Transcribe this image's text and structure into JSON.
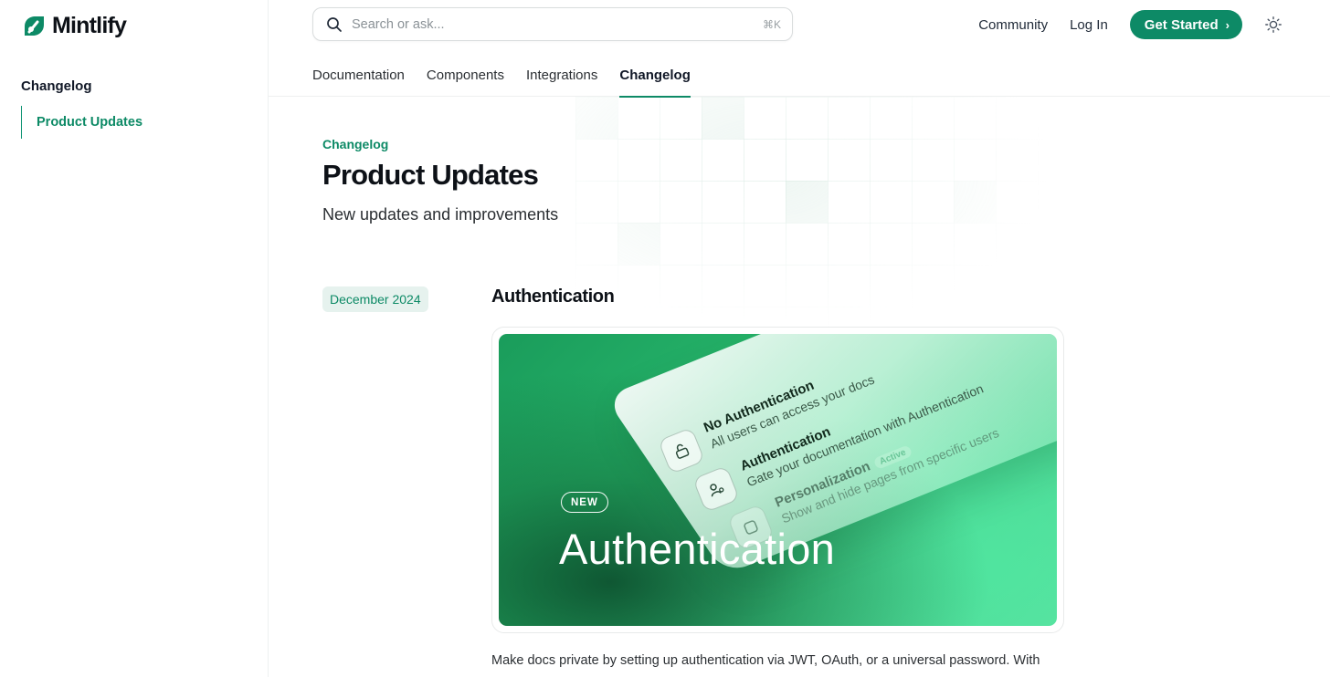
{
  "brand": {
    "name": "Mintlify",
    "accent": "#0d8a66"
  },
  "sidebar": {
    "group": "Changelog",
    "items": [
      {
        "label": "Product Updates",
        "active": true
      }
    ]
  },
  "header": {
    "search": {
      "placeholder": "Search or ask...",
      "shortcut": "⌘K",
      "icon": "search-icon"
    },
    "links": [
      {
        "label": "Community"
      },
      {
        "label": "Log In"
      }
    ],
    "cta": {
      "label": "Get Started",
      "icon": "chevron-right-icon"
    },
    "theme_icon": "sun-icon",
    "tabs": [
      {
        "label": "Documentation",
        "active": false
      },
      {
        "label": "Components",
        "active": false
      },
      {
        "label": "Integrations",
        "active": false
      },
      {
        "label": "Changelog",
        "active": true
      }
    ]
  },
  "page": {
    "eyebrow": "Changelog",
    "title": "Product Updates",
    "subtitle": "New updates and improvements"
  },
  "entry": {
    "date": "December 2024",
    "title": "Authentication",
    "hero": {
      "pill": "NEW",
      "title": "Authentication",
      "options": [
        {
          "title": "No Authentication",
          "desc": "All users can access your docs",
          "icon": "unlock-icon"
        },
        {
          "title": "Authentication",
          "desc": "Gate your documentation with Authentication",
          "icon": "user-key-icon"
        },
        {
          "title": "Personalization",
          "badge": "Active",
          "desc": "Show and hide pages from specific users",
          "icon": "personalization-icon"
        }
      ]
    },
    "body": "Make docs private by setting up authentication via JWT, OAuth, or a universal password. With"
  }
}
